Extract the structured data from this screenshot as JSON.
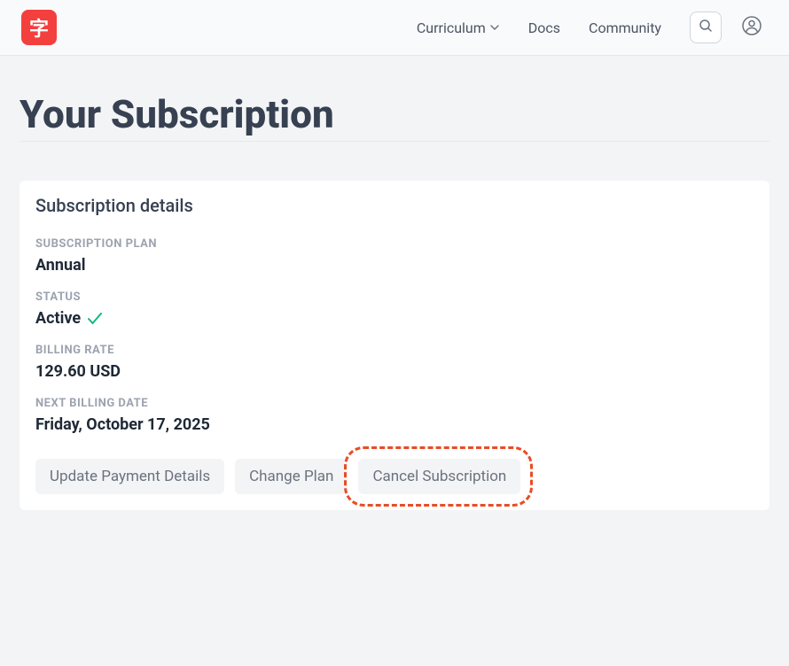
{
  "logo": {
    "character": "字"
  },
  "nav": {
    "curriculum": "Curriculum",
    "docs": "Docs",
    "community": "Community"
  },
  "page": {
    "title": "Your Subscription"
  },
  "card": {
    "title": "Subscription details",
    "fields": {
      "plan_label": "SUBSCRIPTION PLAN",
      "plan_value": "Annual",
      "status_label": "STATUS",
      "status_value": "Active",
      "rate_label": "BILLING RATE",
      "rate_value": "129.60 USD",
      "next_label": "NEXT BILLING DATE",
      "next_value": "Friday, October 17, 2025"
    },
    "buttons": {
      "update_payment": "Update Payment Details",
      "change_plan": "Change Plan",
      "cancel": "Cancel Subscription"
    }
  }
}
